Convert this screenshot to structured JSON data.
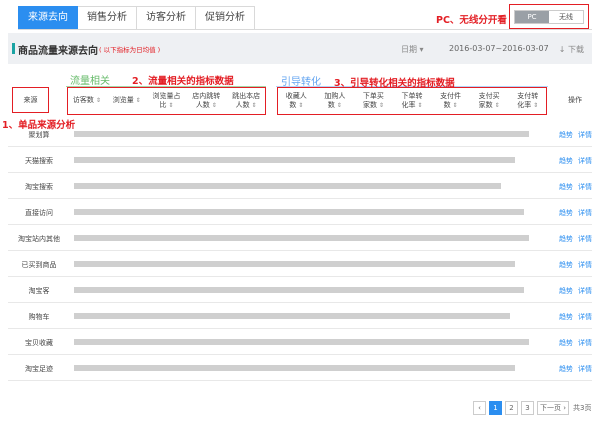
{
  "tabs": [
    {
      "label": "来源去向",
      "active": true
    },
    {
      "label": "销售分析",
      "active": false
    },
    {
      "label": "访客分析",
      "active": false
    },
    {
      "label": "促销分析",
      "active": false
    }
  ],
  "toggle": {
    "on": "PC",
    "off": "无线"
  },
  "annotations": {
    "pc_wireless": "PC、无线分开看",
    "traffic": "2、流量相关的指标数据",
    "conversion": "3、引导转化相关的指标数据",
    "source": "1、单品来源分析"
  },
  "section": {
    "title": "商品流量来源去向",
    "hint": "( 以下指标为日均值 )",
    "date_label": "日期 ▾",
    "date_value": "2016-03-07~2016-03-07",
    "download": "↓ 下载"
  },
  "groups": {
    "traffic": "流量相关",
    "conversion": "引导转化"
  },
  "columns": {
    "source": "来源",
    "traffic": [
      {
        "l1": "访客数",
        "l2": "",
        "sort": true
      },
      {
        "l1": "浏览量",
        "l2": "",
        "sort": true
      },
      {
        "l1": "浏览量占",
        "l2": "比",
        "sort": true
      },
      {
        "l1": "店内跳转",
        "l2": "人数",
        "sort": true
      },
      {
        "l1": "跳出本店",
        "l2": "人数",
        "sort": true
      }
    ],
    "conversion": [
      {
        "l1": "收藏人",
        "l2": "数",
        "sort": true
      },
      {
        "l1": "加购人",
        "l2": "数",
        "sort": true
      },
      {
        "l1": "下单买",
        "l2": "家数",
        "sort": true
      },
      {
        "l1": "下单转",
        "l2": "化率",
        "sort": true
      },
      {
        "l1": "支付件",
        "l2": "数",
        "sort": true
      },
      {
        "l1": "支付买",
        "l2": "家数",
        "sort": true
      },
      {
        "l1": "支付转",
        "l2": "化率",
        "sort": true
      }
    ],
    "action": "操作"
  },
  "rows": [
    {
      "label": "聚划算",
      "fill": 0.96
    },
    {
      "label": "天猫搜索",
      "fill": 0.93
    },
    {
      "label": "淘宝搜索",
      "fill": 0.9
    },
    {
      "label": "直接访问",
      "fill": 0.95
    },
    {
      "label": "淘宝站内其他",
      "fill": 0.96
    },
    {
      "label": "已买到商品",
      "fill": 0.93
    },
    {
      "label": "淘宝客",
      "fill": 0.95
    },
    {
      "label": "购物车",
      "fill": 0.92
    },
    {
      "label": "宝贝收藏",
      "fill": 0.96
    },
    {
      "label": "淘宝足迹",
      "fill": 0.93
    }
  ],
  "row_actions": {
    "trend": "趋势",
    "detail": "详情"
  },
  "pagination": {
    "prev": "‹",
    "pages": [
      "1",
      "2",
      "3"
    ],
    "active_page": "1",
    "next": "下一页 ›",
    "total": "共3页"
  }
}
